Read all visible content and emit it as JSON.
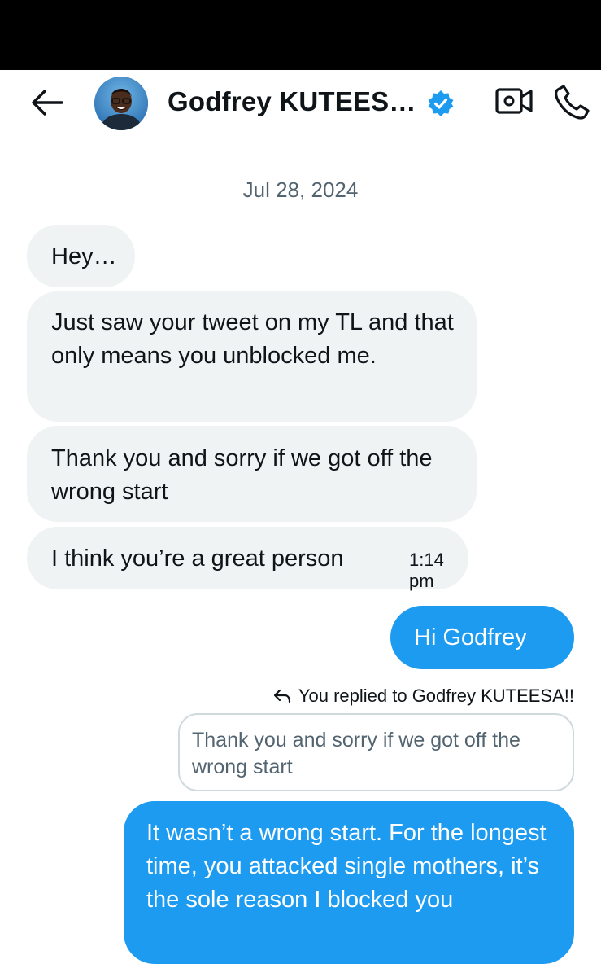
{
  "header": {
    "contact_name": "Godfrey KUTEES…",
    "icons": {
      "back": "arrow-left-icon",
      "verified": "verified-badge-icon",
      "video": "video-call-icon",
      "call": "phone-icon"
    }
  },
  "conversation": {
    "date": "Jul 28, 2024",
    "incoming": [
      {
        "text": "Hey…"
      },
      {
        "text": "Just saw your tweet on my TL and that only means you unblocked me."
      },
      {
        "text": "Thank you and sorry if we got off the wrong start"
      },
      {
        "text": "I think you’re a great person",
        "time": "1:14 pm"
      }
    ],
    "outgoing": [
      {
        "text": "Hi Godfrey"
      },
      {
        "reply_note": "You replied to Godfrey KUTEESA!!",
        "quoted_text": "Thank you and sorry if we got off the wrong start",
        "text": "It wasn’t a wrong start. For the longest time, you attacked single mothers, it’s the sole reason I blocked you"
      }
    ]
  },
  "colors": {
    "accent": "#1d9bf0",
    "incoming_bubble": "#eff3f4",
    "muted_text": "#536471"
  }
}
